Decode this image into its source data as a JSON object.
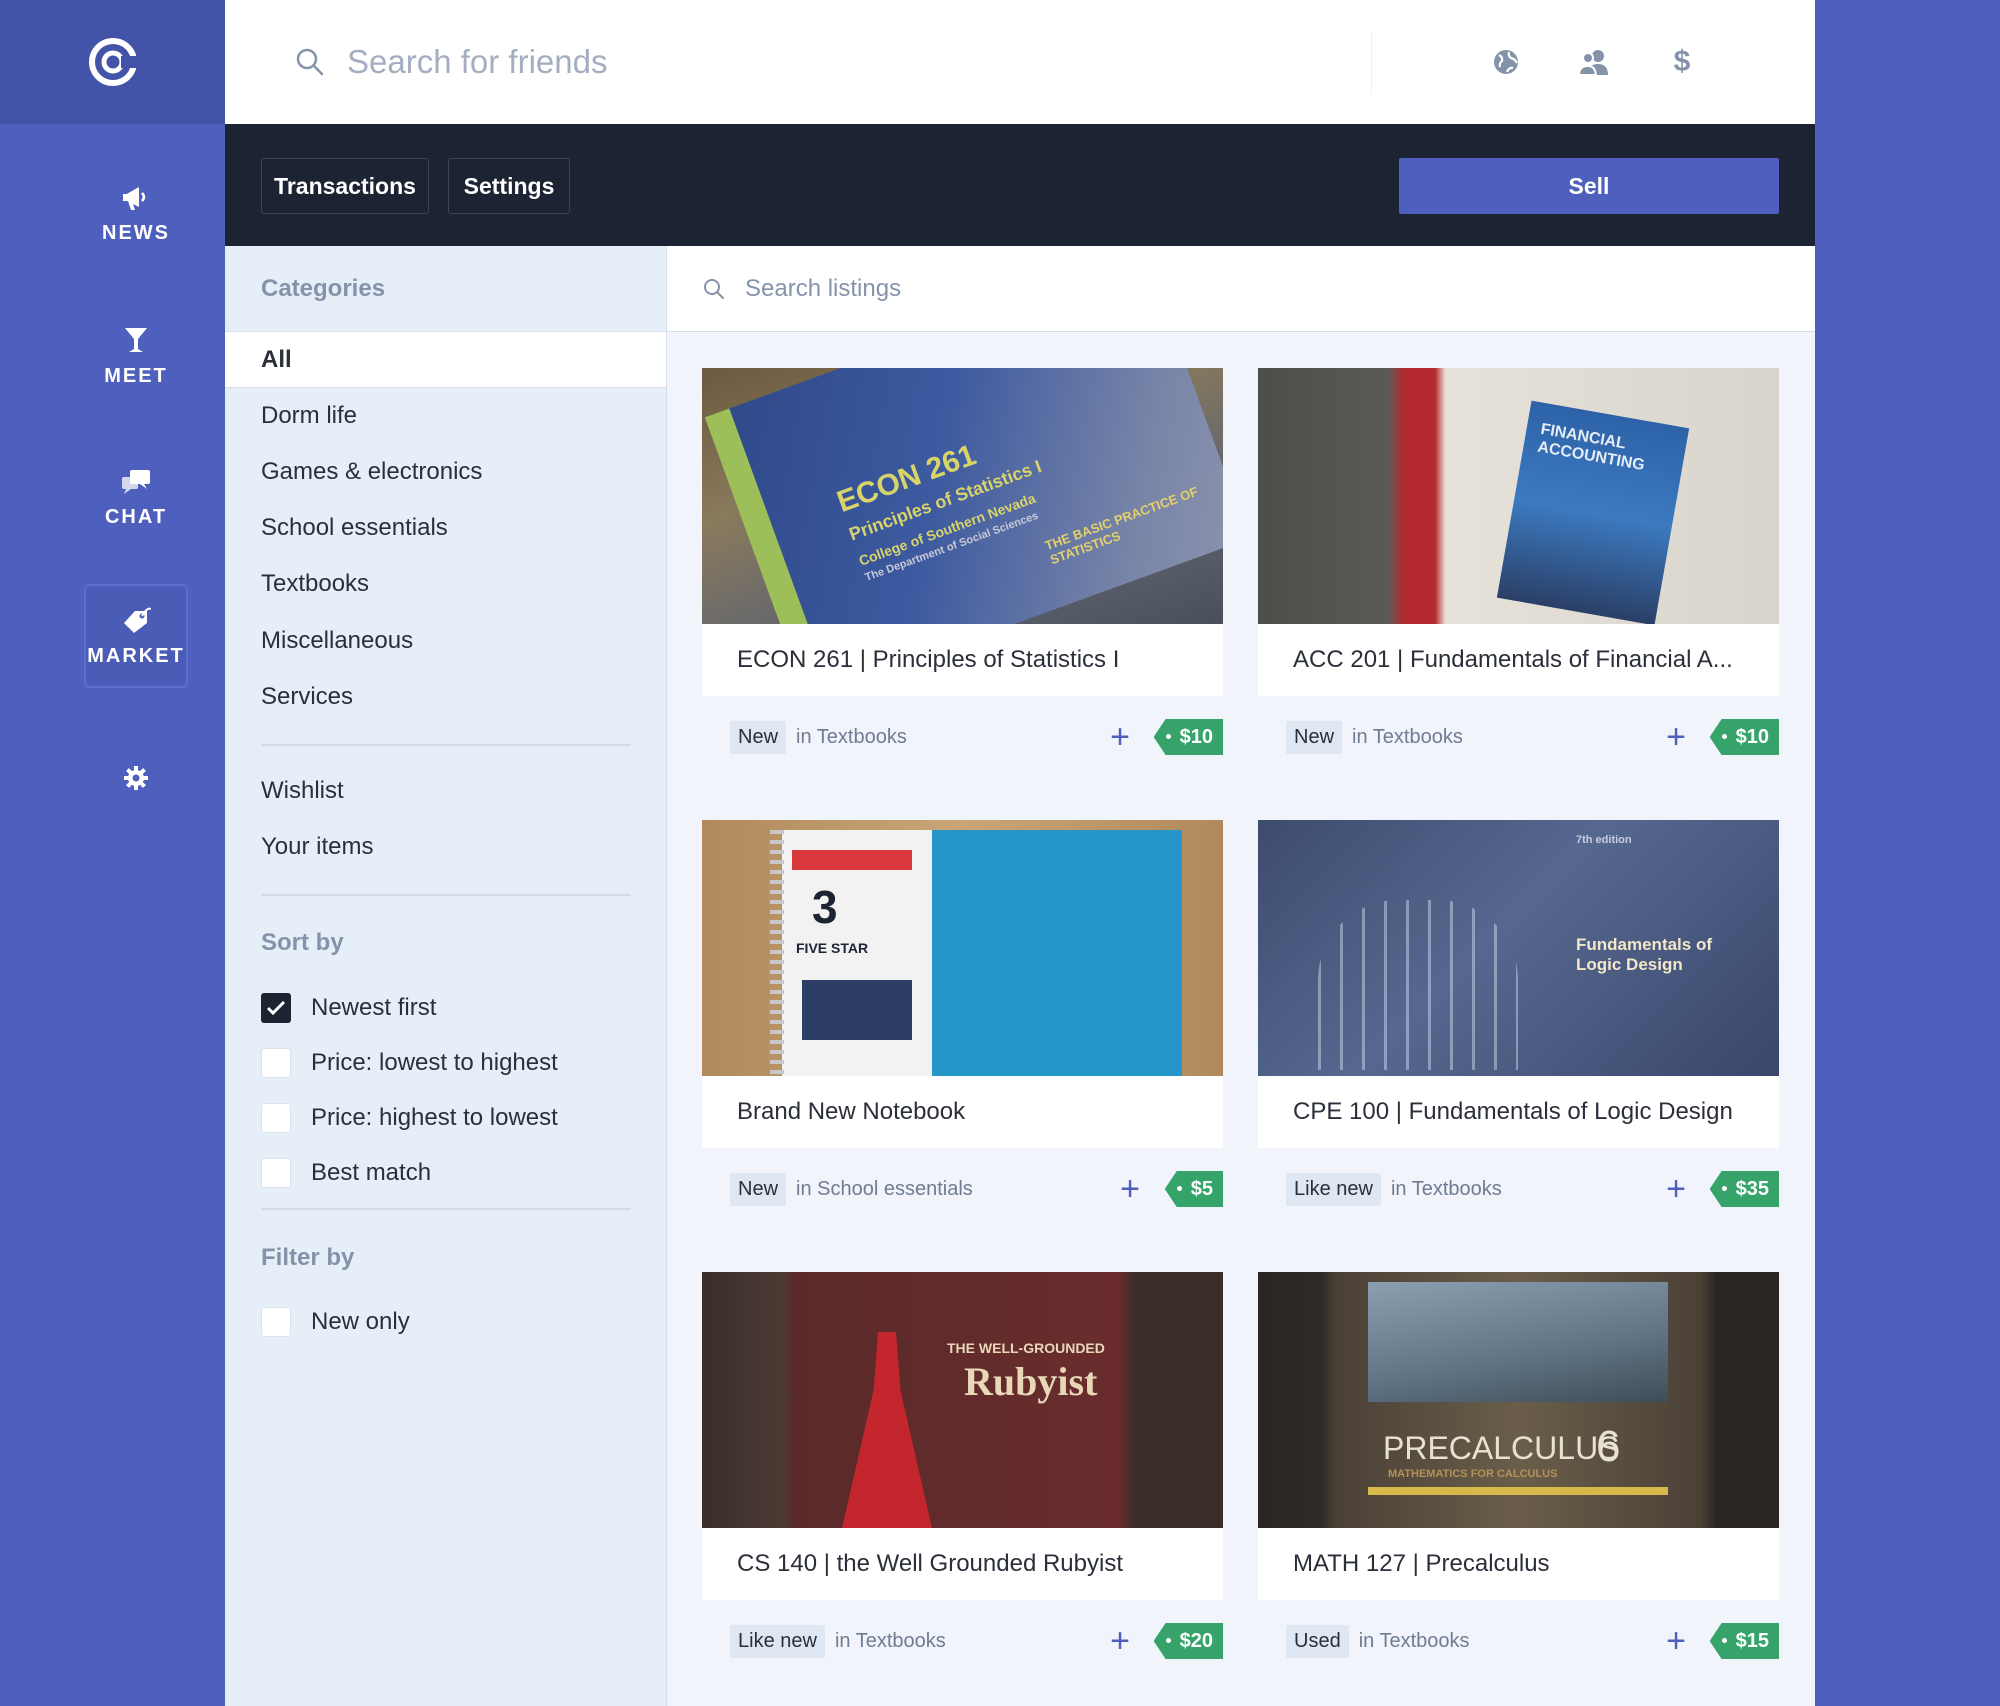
{
  "topbar": {
    "friend_search_placeholder": "Search for friends",
    "icons": [
      "globe-icon",
      "people-icon",
      "dollar-icon"
    ]
  },
  "nav": {
    "items": [
      {
        "label": "NEWS",
        "icon": "megaphone-icon"
      },
      {
        "label": "MEET",
        "icon": "cocktail-icon"
      },
      {
        "label": "CHAT",
        "icon": "chat-bubbles-icon"
      },
      {
        "label": "MARKET",
        "icon": "price-tag-icon",
        "active": true
      }
    ],
    "settings_icon": "gear-icon"
  },
  "subnav": {
    "transactions_label": "Transactions",
    "settings_label": "Settings",
    "sell_label": "Sell"
  },
  "sidebar": {
    "categories_header": "Categories",
    "categories": [
      "All",
      "Dorm life",
      "Games & electronics",
      "School essentials",
      "Textbooks",
      "Miscellaneous",
      "Services"
    ],
    "active_category": "All",
    "personal": [
      "Wishlist",
      "Your items"
    ],
    "sort_header": "Sort by",
    "sort_options": [
      {
        "label": "Newest first",
        "checked": true
      },
      {
        "label": "Price: lowest to highest",
        "checked": false
      },
      {
        "label": "Price: highest to lowest",
        "checked": false
      },
      {
        "label": "Best match",
        "checked": false
      }
    ],
    "filter_header": "Filter by",
    "filter_options": [
      {
        "label": "New only",
        "checked": false
      }
    ]
  },
  "listings_search": {
    "placeholder": "Search listings"
  },
  "listings": [
    {
      "title": "ECON 261 | Principles of Statistics I",
      "condition": "New",
      "category": "in Textbooks",
      "price": "$10"
    },
    {
      "title": "ACC 201 | Fundamentals of Financial A...",
      "condition": "New",
      "category": "in Textbooks",
      "price": "$10"
    },
    {
      "title": "Brand New Notebook",
      "condition": "New",
      "category": "in School essentials",
      "price": "$5"
    },
    {
      "title": "CPE 100 | Fundamentals of Logic Design",
      "condition": "Like new",
      "category": "in Textbooks",
      "price": "$35"
    },
    {
      "title": "CS 140 | the Well Grounded Rubyist",
      "condition": "Like new",
      "category": "in Textbooks",
      "price": "$20"
    },
    {
      "title": "MATH 127 | Precalculus",
      "condition": "Used",
      "category": "in Textbooks",
      "price": "$15"
    }
  ],
  "image_text": {
    "econ": "ECON 261",
    "econ_sub": "Principles of Statistics I",
    "econ_college": "College of Southern Nevada",
    "econ_dept": "The Department of Social Sciences",
    "econ_practice": "THE BASIC PRACTICE OF STATISTICS",
    "acc": "FINANCIAL ACCOUNTING",
    "notebook_num": "3",
    "notebook_brand": "FIVE STAR",
    "logic": "Fundamentals of Logic Design",
    "logic_ed": "7th edition",
    "ruby_small": "THE WELL-GROUNDED",
    "ruby": "Rubyist",
    "precalc": "PRECALCULUS",
    "precalc_ed": "6",
    "precalc_sub": "MATHEMATICS FOR CALCULUS"
  },
  "colors": {
    "brand": "#4f5fbd",
    "dark": "#1c2333",
    "price_green": "#35a36a",
    "sidebar_bg": "#e6eef8"
  }
}
